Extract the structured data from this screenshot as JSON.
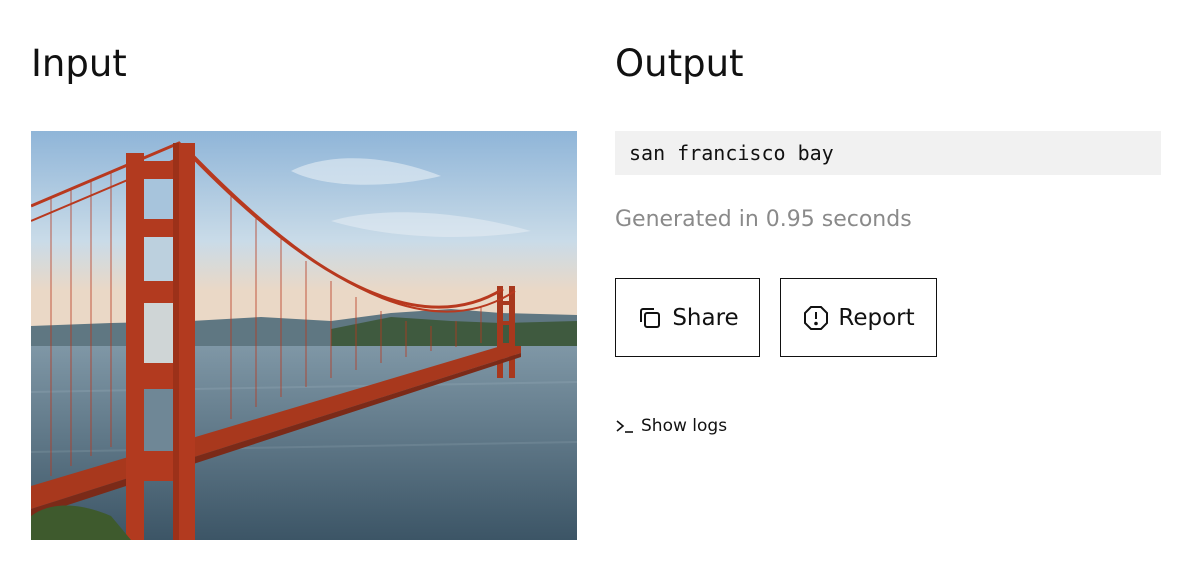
{
  "input": {
    "heading": "Input",
    "image_subject": "golden-gate-bridge-photo"
  },
  "output": {
    "heading": "Output",
    "result_text": "san francisco bay",
    "generation_time": "Generated in 0.95 seconds"
  },
  "actions": {
    "share_label": "Share",
    "share_icon": "copy-icon",
    "report_label": "Report",
    "report_icon": "alert-octagon-icon"
  },
  "logs": {
    "label": "Show logs",
    "icon": "terminal-prompt-icon"
  },
  "colors": {
    "text": "#111111",
    "muted": "#8a8a8a",
    "output_bg": "#f1f1f1",
    "bridge": "#b8391f"
  }
}
